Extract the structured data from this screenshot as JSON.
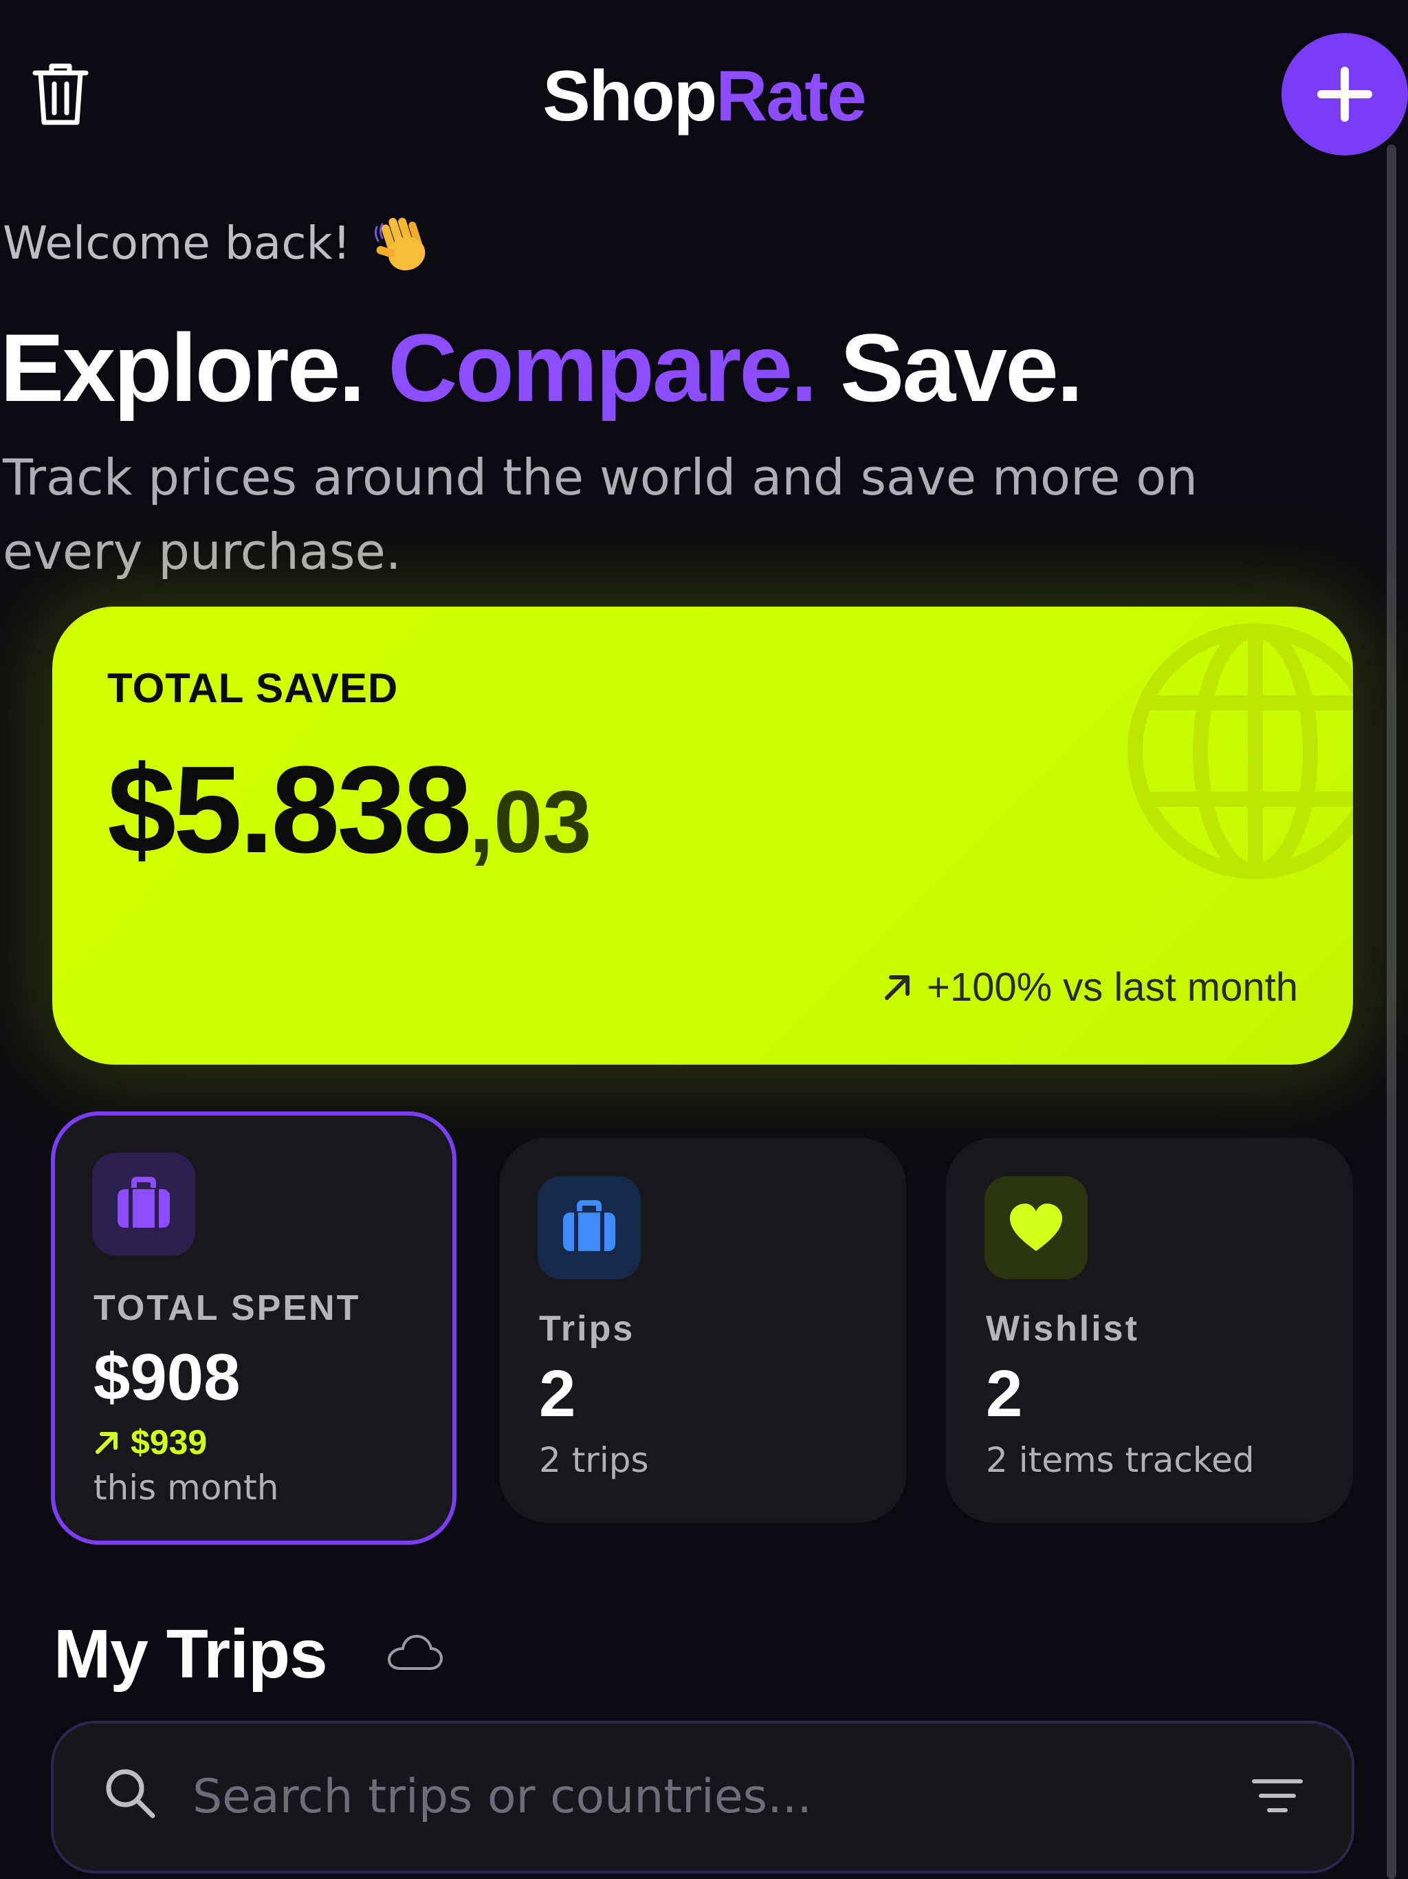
{
  "header": {
    "logo_part1": "Shop",
    "logo_part2": "Rate",
    "trash_icon": "trash-icon",
    "add_icon": "plus-icon"
  },
  "hero": {
    "welcome": "Welcome back!",
    "wave_icon": "waving-hand-icon",
    "headline_1": "Explore.",
    "headline_2": "Compare.",
    "headline_3": "Save.",
    "subtitle": "Track prices around the world and save more on every purchase."
  },
  "total_saved": {
    "label": "TOTAL SAVED",
    "amount_main": "$5.838",
    "amount_cents": ",03",
    "trend": "+100% vs last month"
  },
  "stats": [
    {
      "label": "TOTAL SPENT",
      "value": "$908",
      "delta": "$939",
      "note": "this month",
      "icon": "briefcase-icon"
    },
    {
      "label": "Trips",
      "value": "2",
      "note": "2 trips",
      "icon": "briefcase-icon"
    },
    {
      "label": "Wishlist",
      "value": "2",
      "note": "2 items tracked",
      "icon": "heart-icon"
    }
  ],
  "my_trips": {
    "title": "My Trips",
    "search_placeholder": "Search trips or countries..."
  },
  "colors": {
    "background": "#0b0a10",
    "accent_purple": "#8b4dff",
    "accent_lime": "#ccff00",
    "card_dark": "#18181c"
  }
}
